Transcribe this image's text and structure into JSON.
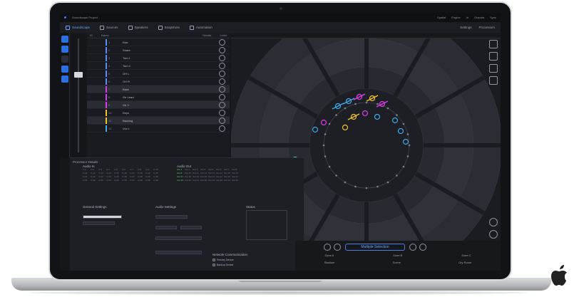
{
  "app": {
    "title": "Soundscape Project",
    "status_items": [
      "Spatial",
      "Engine",
      "In",
      "Outputs",
      "Sync"
    ],
    "toolbar_right": [
      "Settings",
      "Processors"
    ]
  },
  "tabs": [
    {
      "label": "Soundscape",
      "active": true
    },
    {
      "label": "Sources",
      "active": false
    },
    {
      "label": "Speakers",
      "active": false
    },
    {
      "label": "Snapshots",
      "active": false
    },
    {
      "label": "Automation",
      "active": false
    }
  ],
  "object_list": {
    "headers": [
      "ID",
      "Name",
      "Details",
      "Level"
    ],
    "rows": [
      {
        "num": "1",
        "name": "Kick",
        "color": "#5b8df7"
      },
      {
        "num": "2",
        "name": "Snare",
        "color": "#5b8df7"
      },
      {
        "num": "3",
        "name": "Tom 1",
        "color": "#5b8df7"
      },
      {
        "num": "4",
        "name": "Tom 2",
        "color": "#5b8df7"
      },
      {
        "num": "5",
        "name": "OH L",
        "color": "#5b8df7"
      },
      {
        "num": "6",
        "name": "OH R",
        "color": "#5b8df7"
      },
      {
        "num": "7",
        "name": "Bass",
        "color": "#d93de8",
        "selected": true
      },
      {
        "num": "8",
        "name": "Gtr Lead",
        "color": "#d93de8"
      },
      {
        "num": "9",
        "name": "Gtr 2",
        "color": "#d93de8",
        "selected": true
      },
      {
        "num": "10",
        "name": "Keys",
        "color": "#f2c230"
      },
      {
        "num": "11",
        "name": "Backing",
        "color": "#f2c230",
        "selected": true
      },
      {
        "num": "12",
        "name": "Vox L",
        "color": "#3fa8e8"
      }
    ]
  },
  "bottom_panel": {
    "title": "Processor Details",
    "audio_in_label": "Audio In",
    "audio_out_label": "Audio Out",
    "general_label": "General Settings",
    "audio_settings_label": "Audio Settings",
    "status_label": "Status",
    "network_label": "Network Communication",
    "radio_a": "Primary Device",
    "radio_b": "Backup Device",
    "grid_in": [
      "In 1",
      "In 2",
      "In 3",
      "In 4",
      "In 5",
      "In 6",
      "In 7",
      "In 8",
      "In 9",
      "In 10",
      "In 11",
      "In 12",
      "In 13",
      "In 14",
      "In 15",
      "In 16",
      "In 17",
      "In 18",
      "In 19",
      "In 20",
      "In 21",
      "In 22",
      "In 23",
      "In 24",
      "In 25",
      "In 26",
      "In 27",
      "In 28",
      "In 29",
      "In 30",
      "In 31",
      "In 32",
      "In 33",
      "In 34",
      "In 35",
      "In 36",
      "In 37",
      "In 38",
      "In 39",
      "In 40"
    ],
    "grid_out": [
      "Out 1",
      "Out 2",
      "Out 3",
      "Out 4",
      "Out 5",
      "Out 6",
      "Out 7",
      "Out 8",
      "Out 9",
      "Out 10",
      "Out 11",
      "Out 12",
      "Out 13",
      "Out 14",
      "Out 15",
      "Out 16",
      "Out 17",
      "Out 18",
      "Out 19",
      "Out 20",
      "Out 21",
      "Out 22",
      "Out 23",
      "Out 24",
      "Out 25",
      "Out 26",
      "Out 27",
      "Out 28",
      "Out 29",
      "Out 30",
      "Out 31",
      "Out 32"
    ]
  },
  "transport": {
    "selection": "Multiple Selection",
    "labels": [
      "Zone A",
      "Zone B",
      "Zone C"
    ],
    "values": [
      "Stadium",
      "Scene",
      "Dry Room"
    ]
  },
  "colors": {
    "accent": "#3b82f6",
    "magenta": "#d93de8",
    "yellow": "#f2c230",
    "cyan": "#3fa8e8"
  },
  "icons": [
    "soundscape-icon",
    "sources-icon",
    "speakers-icon",
    "snapshots-icon",
    "automation-icon",
    "settings-icon",
    "processors-icon",
    "bell-icon",
    "apple-logo-icon"
  ]
}
